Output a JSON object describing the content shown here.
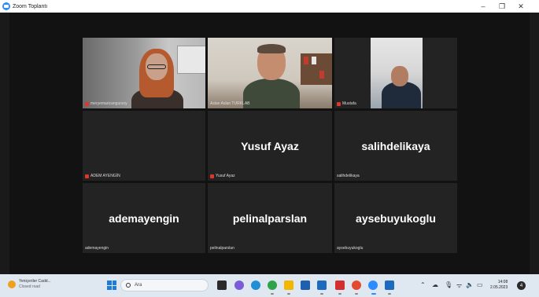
{
  "window": {
    "title": "Zoom Toplantı",
    "minimize": "–",
    "maximize": "❐",
    "close": "✕"
  },
  "participants": [
    {
      "name": "meryemaricangursoy",
      "video": true,
      "muted": true,
      "active": false
    },
    {
      "name": "Aslan Aslan TURKLAB",
      "video": true,
      "muted": false,
      "active": true
    },
    {
      "name": "Mustafa",
      "video": true,
      "muted": true,
      "active": false
    },
    {
      "name": "ADEM AYENGİN",
      "video": false,
      "muted": true,
      "display": ""
    },
    {
      "name": "Yusuf Ayaz",
      "video": false,
      "muted": true,
      "display": "Yusuf Ayaz"
    },
    {
      "name": "salihdelikaya",
      "video": false,
      "muted": false,
      "display": "salihdelikaya"
    },
    {
      "name": "ademayengin",
      "video": false,
      "muted": false,
      "display": "ademayengin"
    },
    {
      "name": "pelinalparslan",
      "video": false,
      "muted": false,
      "display": "pelinalparslan"
    },
    {
      "name": "aysebuyukoglu",
      "video": false,
      "muted": false,
      "display": "aysebuyukoglu"
    }
  ],
  "taskbar": {
    "weather_title": "Yeniçeriler Cadd...",
    "weather_sub": "Closed road",
    "search_placeholder": "Ara",
    "time": "14:08",
    "date": "2.05.2023",
    "notification_count": "4"
  },
  "colors": {
    "active_speaker_border": "#a4d55a",
    "muted_icon": "#e0352b",
    "meeting_bg": "#1a1a1a",
    "taskbar_bg": "#dfe7f1"
  }
}
